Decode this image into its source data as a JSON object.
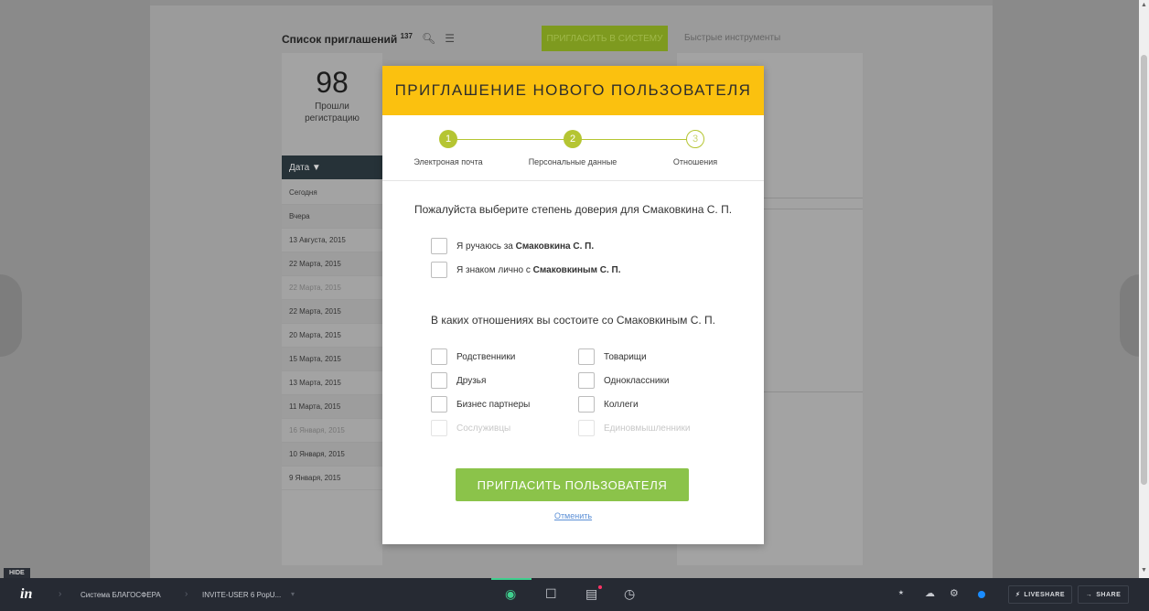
{
  "background": {
    "list_title": "Список приглашений",
    "list_count": "137",
    "invite_button": "ПРИГЛАСИТЬ В СИСТЕМУ",
    "quick_tools": "Быстрые инструменты",
    "stat_number": "98",
    "stat_label_line1": "Прошли",
    "stat_label_line2": "регистрацию",
    "date_column": "Дата ▼",
    "rows": [
      "Сегодня",
      "Вчера",
      "13 Августа, 2015",
      "22 Марта, 2015",
      "22 Марта, 2015",
      "22 Марта, 2015",
      "20 Марта, 2015",
      "15 Марта, 2015",
      "13 Марта, 2015",
      "11 Марта, 2015",
      "16 Января, 2015",
      "10 Января, 2015",
      "9 Января, 2015"
    ]
  },
  "modal": {
    "title": "ПРИГЛАШЕНИЕ НОВОГО ПОЛЬЗОВАТЕЛЯ",
    "steps": [
      {
        "number": "1",
        "label": "Электроная почта"
      },
      {
        "number": "2",
        "label": "Персональные данные"
      },
      {
        "number": "3",
        "label": "Отношения"
      }
    ],
    "trust_question": "Пожалуйста выберите степень доверия для Смаковкина С. П.",
    "trust_options": [
      {
        "prefix": "Я ручаюсь за ",
        "name": "Смаковкина С. П."
      },
      {
        "prefix": "Я знаком лично с ",
        "name": "Смаковкиным С. П."
      }
    ],
    "relation_question": "В каких отношениях вы состоите со Смаковкиным С. П.",
    "relations_left": [
      "Родственники",
      "Друзья",
      "Бизнес партнеры",
      "Сослуживцы"
    ],
    "relations_right": [
      "Товарищи",
      "Одноклассники",
      "Коллеги",
      "Единовмышленники"
    ],
    "submit_button": "ПРИГЛАСИТЬ ПОЛЬЗОВАТЕЛЯ",
    "cancel_link": "Отменить"
  },
  "invision_bar": {
    "hide_label": "HIDE",
    "logo": "in",
    "project": "Система БЛАГОСФЕРА",
    "screen": "INVITE-USER 6 PopU...",
    "liveshare_label": "LIVESHARE",
    "share_label": "SHARE"
  },
  "colors": {
    "header_yellow": "#fbc10f",
    "step_green": "#b5c532",
    "button_green": "#8bc34a",
    "link_blue": "#5b8fd6",
    "bar_dark": "#262a33"
  }
}
